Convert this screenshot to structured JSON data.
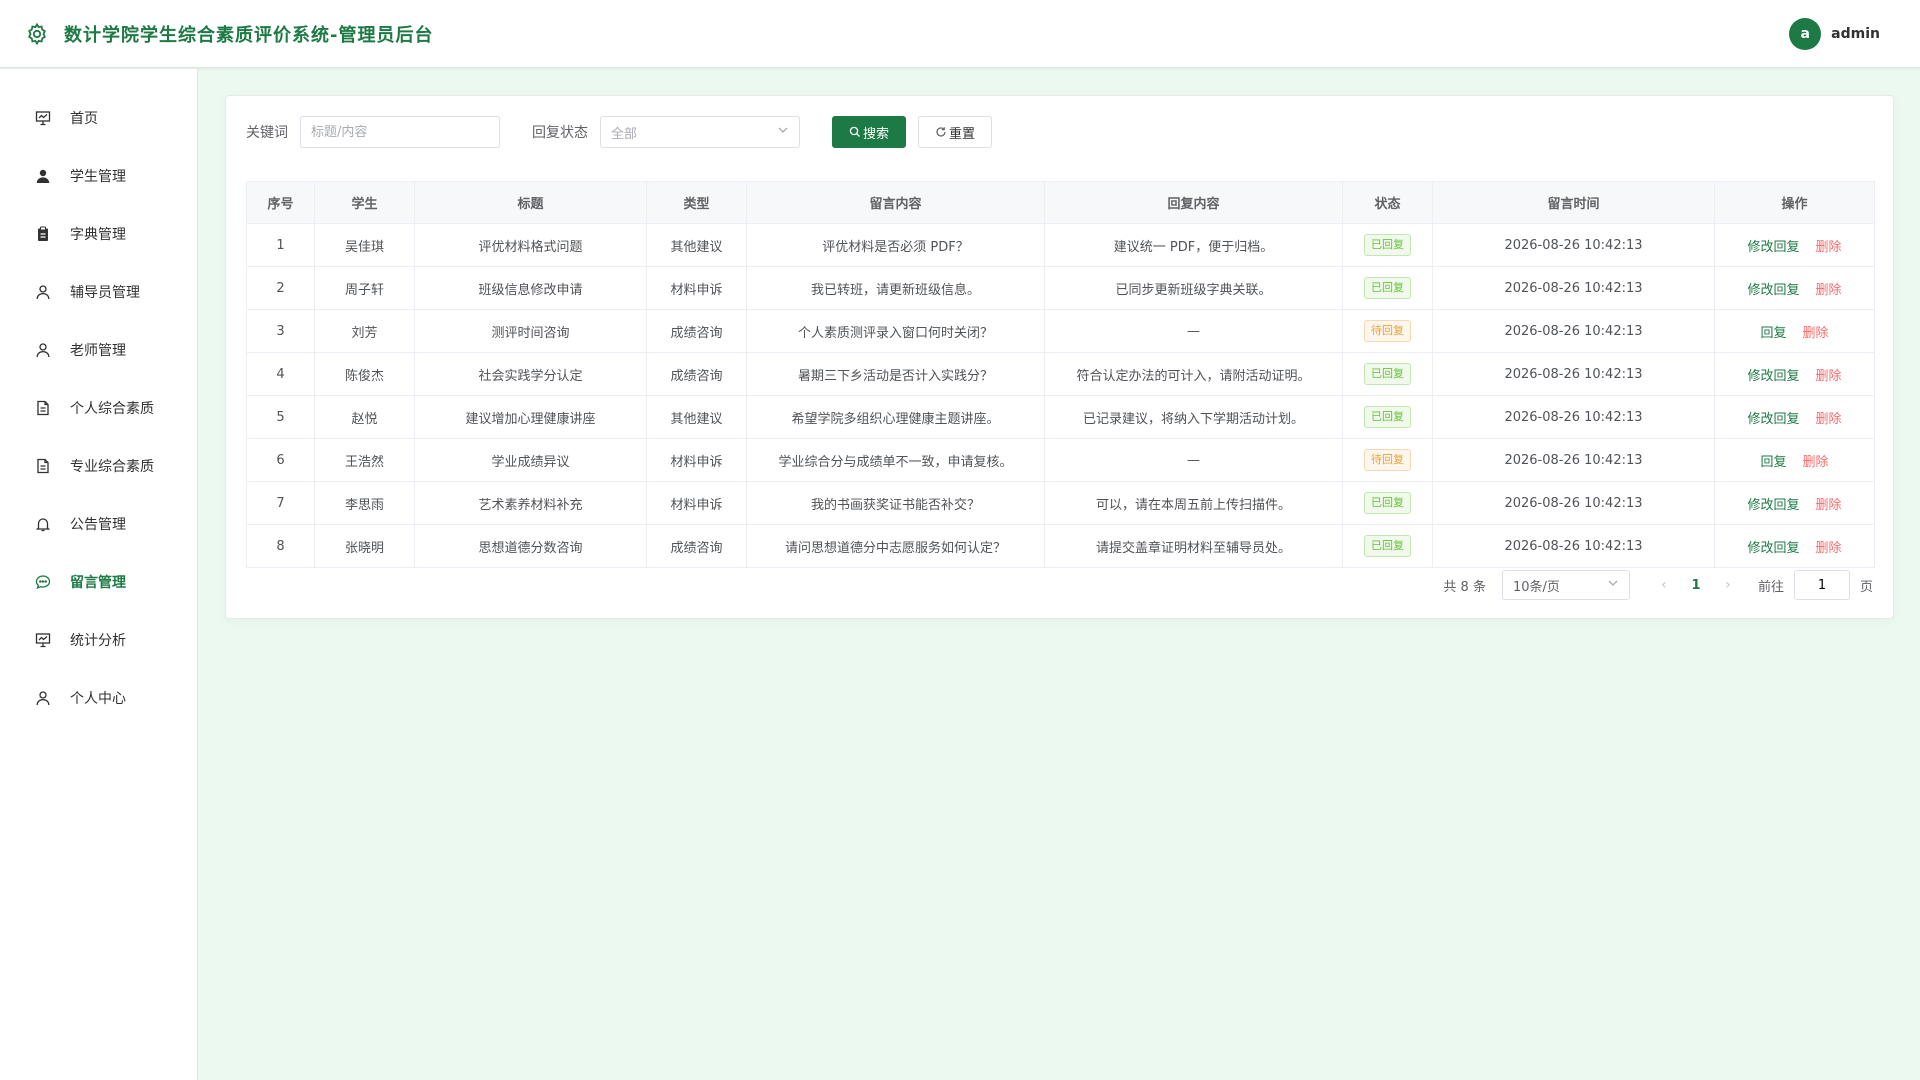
{
  "header": {
    "title": "数计学院学生综合素质评价系统-管理员后台",
    "logo_icon": "gear-icon",
    "avatar_letter": "a",
    "username": "admin",
    "accent": "#1e7a45"
  },
  "sidebar": {
    "items": [
      {
        "label": "首页",
        "icon": "presentation-icon",
        "active": false
      },
      {
        "label": "学生管理",
        "icon": "user-filled-icon",
        "active": false
      },
      {
        "label": "字典管理",
        "icon": "clipboard-icon",
        "active": false
      },
      {
        "label": "辅导员管理",
        "icon": "user-icon",
        "active": false
      },
      {
        "label": "老师管理",
        "icon": "user-icon",
        "active": false
      },
      {
        "label": "个人综合素质",
        "icon": "document-icon",
        "active": false
      },
      {
        "label": "专业综合素质",
        "icon": "document-icon",
        "active": false
      },
      {
        "label": "公告管理",
        "icon": "bell-icon",
        "active": false
      },
      {
        "label": "留言管理",
        "icon": "chat-icon",
        "active": true
      },
      {
        "label": "统计分析",
        "icon": "presentation-icon",
        "active": false
      },
      {
        "label": "个人中心",
        "icon": "user-icon",
        "active": false
      }
    ]
  },
  "filters": {
    "keyword_label": "关键词",
    "keyword_placeholder": "标题/内容",
    "keyword_value": "",
    "status_label": "回复状态",
    "status_value": "全部",
    "search_label": "搜索",
    "reset_label": "重置"
  },
  "table": {
    "columns": [
      "序号",
      "学生",
      "标题",
      "类型",
      "留言内容",
      "回复内容",
      "状态",
      "留言时间",
      "操作"
    ],
    "rows": [
      {
        "no": "1",
        "student": "吴佳琪",
        "title": "评优材料格式问题",
        "type": "其他建议",
        "content": "评优材料是否必须 PDF？",
        "reply": "建议统一 PDF，便于归档。",
        "status": "已回复",
        "time": "2026-08-26 10:42:13",
        "action_edit": "修改回复",
        "action_del": "删除"
      },
      {
        "no": "2",
        "student": "周子轩",
        "title": "班级信息修改申请",
        "type": "材料申诉",
        "content": "我已转班，请更新班级信息。",
        "reply": "已同步更新班级字典关联。",
        "status": "已回复",
        "time": "2026-08-26 10:42:13",
        "action_edit": "修改回复",
        "action_del": "删除"
      },
      {
        "no": "3",
        "student": "刘芳",
        "title": "测评时间咨询",
        "type": "成绩咨询",
        "content": "个人素质测评录入窗口何时关闭？",
        "reply": "—",
        "status": "待回复",
        "time": "2026-08-26 10:42:13",
        "action_edit": "回复",
        "action_del": "删除"
      },
      {
        "no": "4",
        "student": "陈俊杰",
        "title": "社会实践学分认定",
        "type": "成绩咨询",
        "content": "暑期三下乡活动是否计入实践分？",
        "reply": "符合认定办法的可计入，请附活动证明。",
        "status": "已回复",
        "time": "2026-08-26 10:42:13",
        "action_edit": "修改回复",
        "action_del": "删除"
      },
      {
        "no": "5",
        "student": "赵悦",
        "title": "建议增加心理健康讲座",
        "type": "其他建议",
        "content": "希望学院多组织心理健康主题讲座。",
        "reply": "已记录建议，将纳入下学期活动计划。",
        "status": "已回复",
        "time": "2026-08-26 10:42:13",
        "action_edit": "修改回复",
        "action_del": "删除"
      },
      {
        "no": "6",
        "student": "王浩然",
        "title": "学业成绩异议",
        "type": "材料申诉",
        "content": "学业综合分与成绩单不一致，申请复核。",
        "reply": "—",
        "status": "待回复",
        "time": "2026-08-26 10:42:13",
        "action_edit": "回复",
        "action_del": "删除"
      },
      {
        "no": "7",
        "student": "李思雨",
        "title": "艺术素养材料补充",
        "type": "材料申诉",
        "content": "我的书画获奖证书能否补交？",
        "reply": "可以，请在本周五前上传扫描件。",
        "status": "已回复",
        "time": "2026-08-26 10:42:13",
        "action_edit": "修改回复",
        "action_del": "删除"
      },
      {
        "no": "8",
        "student": "张晓明",
        "title": "思想道德分数咨询",
        "type": "成绩咨询",
        "content": "请问思想道德分中志愿服务如何认定？",
        "reply": "请提交盖章证明材料至辅导员处。",
        "status": "已回复",
        "time": "2026-08-26 10:42:13",
        "action_edit": "修改回复",
        "action_del": "删除"
      }
    ]
  },
  "pagination": {
    "total_text": "共 8 条",
    "page_size": "10条/页",
    "current_page": "1",
    "goto_label": "前往",
    "goto_value": "1",
    "page_suffix": "页"
  }
}
